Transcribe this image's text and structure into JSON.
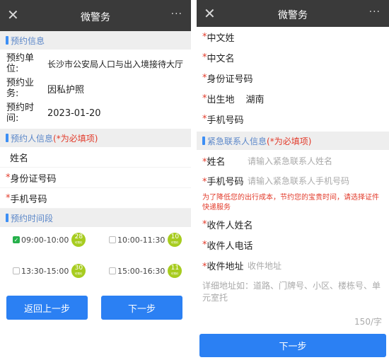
{
  "left": {
    "header": {
      "title": "微警务",
      "close_icon": "✕",
      "more_icon": "···"
    },
    "booking_section": {
      "title": "预约信息"
    },
    "booking_info": {
      "unit_label": "预约单位:",
      "unit_value": "长沙市公安局人口与出入境接待大厅",
      "business_label": "预约业务:",
      "business_value": "因私护照",
      "time_label": "预约时间:",
      "time_value": "2023-01-20"
    },
    "person_section": {
      "title": "预约人信息",
      "required_note": "(*为必填项)"
    },
    "person_fields": {
      "name_label": "姓名",
      "id_label": "身份证号码",
      "phone_label": "手机号码",
      "required_mark": "*"
    },
    "time_section": {
      "title": "预约时间段"
    },
    "slots": [
      {
        "time": "09:00-10:00",
        "count": "28",
        "sub": "可预约",
        "checked": true
      },
      {
        "time": "10:00-11:30",
        "count": "10",
        "sub": "可预约",
        "checked": false
      },
      {
        "time": "13:30-15:00",
        "count": "30",
        "sub": "可预约",
        "checked": false
      },
      {
        "time": "15:00-16:30",
        "count": "11",
        "sub": "可预约",
        "checked": false
      }
    ],
    "buttons": {
      "back": "返回上一步",
      "next": "下一步"
    }
  },
  "right": {
    "header": {
      "title": "微警务",
      "close_icon": "✕",
      "more_icon": "···"
    },
    "fields": {
      "required_mark": "*",
      "chinese_surname": "中文姓",
      "chinese_name": "中文名",
      "id_number": "身份证号码",
      "birthplace_label": "出生地",
      "birthplace_value": "湖南",
      "phone": "手机号码"
    },
    "emergency_section": {
      "title": "紧急联系人信息",
      "required_note": "(*为必填项)"
    },
    "emergency": {
      "name_label": "姓名",
      "name_placeholder": "请输入紧急联系人姓名",
      "phone_label": "手机号码",
      "phone_placeholder": "请输入紧急联系人手机号码"
    },
    "notice": "为了降低您的出行成本，节约您的宝贵时间，请选择证件快递服务",
    "delivery": {
      "recipient_name": "收件人姓名",
      "recipient_phone": "收件人电话",
      "address_label": "收件地址",
      "address_placeholder": "收件地址",
      "detail_placeholder": "详细地址如：道路、门牌号、小区、楼栋号、单元室托",
      "counter": "150/字"
    },
    "next_button": "下一步"
  },
  "colors": {
    "accent": "#2b80f3",
    "required": "#e23a2a",
    "badge": "#a7cc1f",
    "checked": "#26b04b",
    "header": "#3a3a3a"
  }
}
